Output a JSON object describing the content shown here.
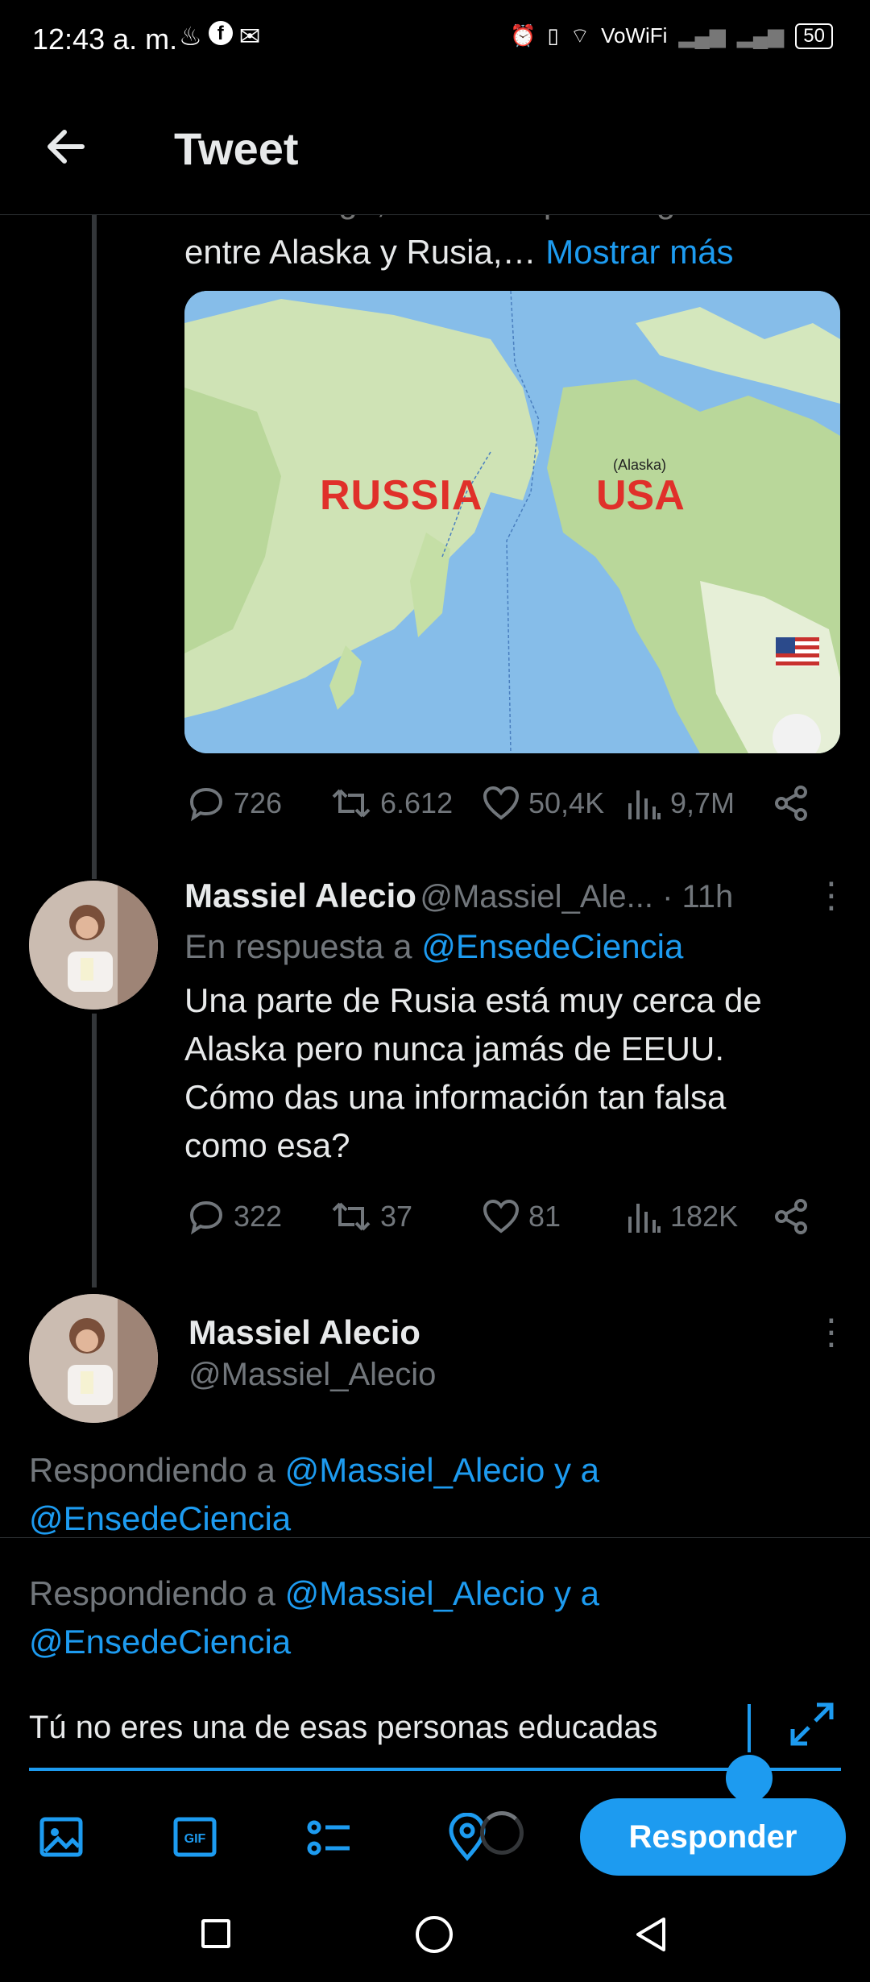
{
  "status_bar": {
    "time": "12:43 a. m.",
    "network": "VoWiFi",
    "battery": "50"
  },
  "header": {
    "title": "Tweet"
  },
  "original_tweet": {
    "text_partial_hidden": "Sin embargo, en el cuerpo de agua",
    "text_visible": "entre Alaska y Rusia,…",
    "show_more": "Mostrar más",
    "map": {
      "label_russia": "RUSSIA",
      "label_usa": "USA",
      "label_alaska": "(Alaska)"
    },
    "stats": {
      "replies": "726",
      "retweets": "6.612",
      "likes": "50,4K",
      "views": "9,7M"
    }
  },
  "reply_tweet": {
    "name": "Massiel Alecio",
    "handle_time": "@Massiel_Ale... · 11h",
    "replying_to_prefix": "En respuesta a ",
    "replying_to": "@EnsedeCiencia",
    "text_lines": [
      "Una parte de Rusia está muy cerca de",
      "Alaska pero nunca jamás de EEUU.",
      "Cómo das una información tan falsa",
      "como esa?"
    ],
    "stats": {
      "replies": "322",
      "retweets": "37",
      "likes": "81",
      "views": "182K"
    }
  },
  "author_card": {
    "name": "Massiel Alecio",
    "handle": "@Massiel_Alecio",
    "replying_prefix": "Respondiendo a ",
    "replying_users_line1": "@Massiel_Alecio y a",
    "replying_users_line2": "@EnsedeCiencia"
  },
  "composer": {
    "replying_prefix": "Respondiendo a ",
    "replying_users_line1": "@Massiel_Alecio y a",
    "replying_users_line2": "@EnsedeCiencia",
    "draft_text": "Tú no eres una de esas personas educadas",
    "submit_label": "Responder"
  },
  "colors": {
    "accent": "#1d9bf0",
    "muted": "#71767b",
    "background": "#000000"
  }
}
